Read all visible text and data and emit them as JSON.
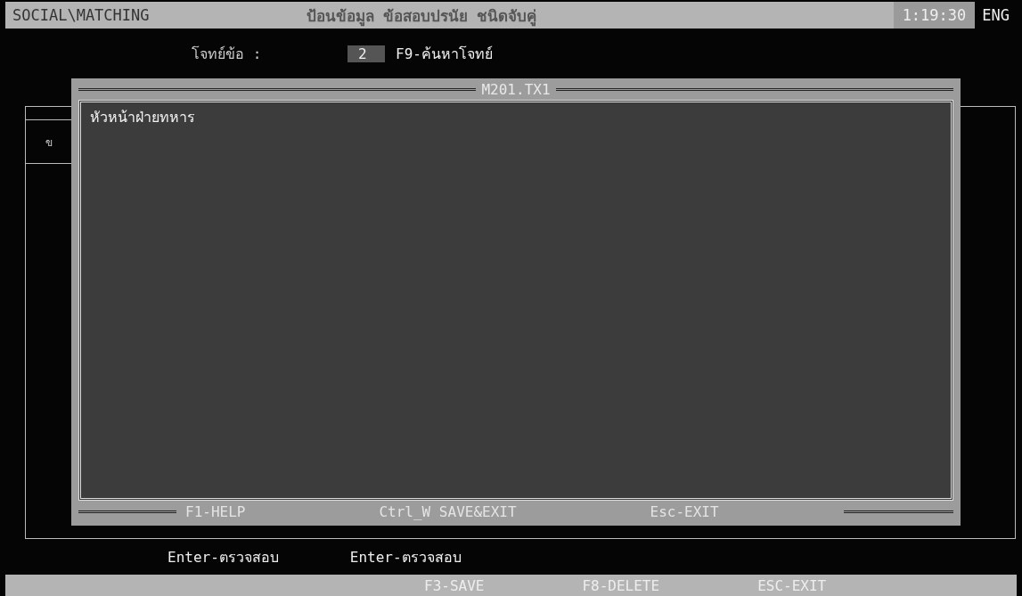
{
  "header": {
    "app": "SOCIAL\\MATCHING",
    "title": "ป้อนข้อมูล ข้อสอบปรนัย ชนิดจับคู่",
    "time": "1:19:30",
    "language": "ENG"
  },
  "question": {
    "label": "โจทย์ข้อ :",
    "value": "2",
    "hint": "F9-ค้นหาโจทย์"
  },
  "side_label": "ข",
  "dialog": {
    "title": "M201.TX1",
    "text": "หัวหน้าฝ่ายทหาร",
    "keys": [
      "F1-HELP",
      "Ctrl_W SAVE&EXIT",
      "Esc-EXIT"
    ]
  },
  "hints": [
    "Enter-ตรวจสอบ",
    "Enter-ตรวจสอบ"
  ],
  "function_keys": [
    "F3-SAVE",
    "F8-DELETE",
    "ESC-EXIT"
  ]
}
